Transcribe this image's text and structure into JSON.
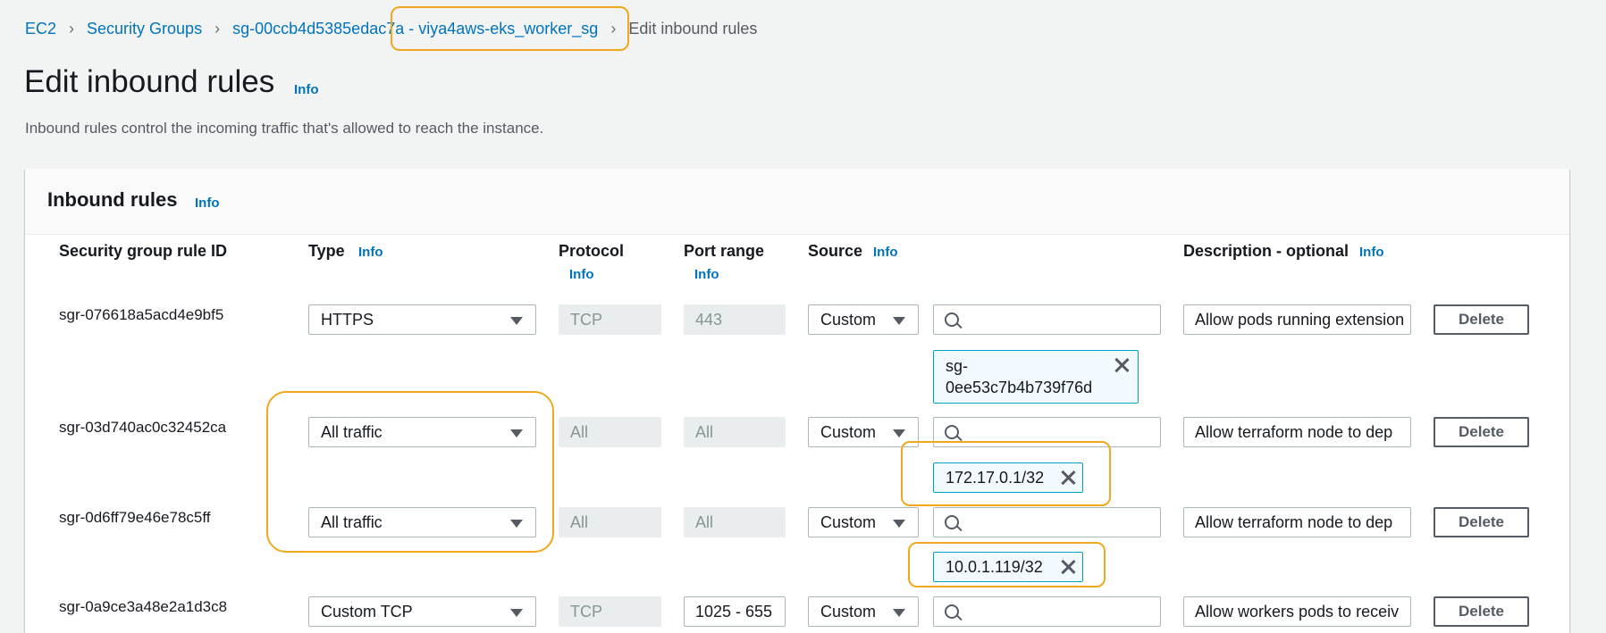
{
  "breadcrumb": {
    "items": [
      "EC2",
      "Security Groups",
      "sg-00ccb4d5385edac7a - viya4aws-eks_worker_sg"
    ],
    "current": "Edit inbound rules"
  },
  "page": {
    "title": "Edit inbound rules",
    "info": "Info",
    "subtitle": "Inbound rules control the incoming traffic that's allowed to reach the instance."
  },
  "panel": {
    "title": "Inbound rules",
    "info": "Info",
    "columns": {
      "rule_id": "Security group rule ID",
      "type": "Type",
      "protocol": "Protocol",
      "port_range": "Port range",
      "source": "Source",
      "description": "Description - optional",
      "info": "Info"
    }
  },
  "rules": [
    {
      "id": "sgr-076618a5acd4e9bf5",
      "type": "HTTPS",
      "protocol": "TCP",
      "port": "443",
      "source": "Custom",
      "description": "Allow pods running extension",
      "token": "sg-0ee53c7b4b739f76d",
      "token_line1": "sg-",
      "token_line2": "0ee53c7b4b739f76d",
      "delete": "Delete"
    },
    {
      "id": "sgr-03d740ac0c32452ca",
      "type": "All traffic",
      "protocol": "All",
      "port": "All",
      "source": "Custom",
      "description": "Allow terraform node to dep",
      "token": "172.17.0.1/32",
      "delete": "Delete"
    },
    {
      "id": "sgr-0d6ff79e46e78c5ff",
      "type": "All traffic",
      "protocol": "All",
      "port": "All",
      "source": "Custom",
      "description": "Allow terraform node to dep",
      "token": "10.0.1.119/32",
      "delete": "Delete"
    },
    {
      "id": "sgr-0a9ce3a48e2a1d3c8",
      "type": "Custom TCP",
      "protocol": "TCP",
      "port": "1025 - 655",
      "source": "Custom",
      "description": "Allow workers pods to receiv",
      "delete": "Delete"
    }
  ],
  "colors": {
    "link": "#0073bb",
    "highlight": "#f0a91e",
    "token_border": "#00a1c9",
    "background": "#f2f3f3"
  }
}
